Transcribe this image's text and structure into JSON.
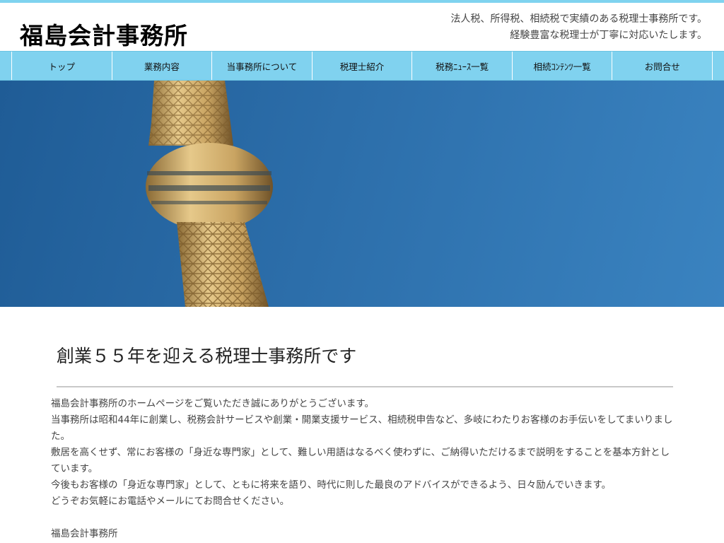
{
  "header": {
    "title": "福島会計事務所",
    "tagline_1": "法人税、所得税、相続税で実績のある税理士事務所です。",
    "tagline_2": "経験豊富な税理士が丁寧に対応いたします。"
  },
  "nav": {
    "items": [
      {
        "label": "トップ"
      },
      {
        "label": "業務内容"
      },
      {
        "label": "当事務所について"
      },
      {
        "label": "税理士紹介"
      },
      {
        "label": "税務ﾆｭｰｽ一覧"
      },
      {
        "label": "相続ｺﾝﾃﾝﾂ一覧"
      },
      {
        "label": "お問合せ"
      }
    ]
  },
  "main": {
    "heading": "創業５５年を迎える税理士事務所です",
    "paragraphs": [
      "福島会計事務所のホームページをご覧いただき誠にありがとうございます。",
      "当事務所は昭和44年に創業し、税務会計サービスや創業・開業支援サービス、相続税申告など、多岐にわたりお客様のお手伝いをしてまいりました。",
      "敷居を高くせず、常にお客様の「身近な専門家」として、難しい用語はなるべく使わずに、ご納得いただけるまで説明をすることを基本方針としています。",
      "今後もお客様の「身近な専門家」として、ともに将来を語り、時代に則した最良のアドバイスができるよう、日々励んでいきます。",
      "どうぞお気軽にお電話やメールにてお問合せください。"
    ],
    "signature": "福島会計事務所"
  },
  "colors": {
    "nav_bg": "#80d2ef",
    "sky": "#2c6eaa",
    "tower": "#d8b87a"
  }
}
